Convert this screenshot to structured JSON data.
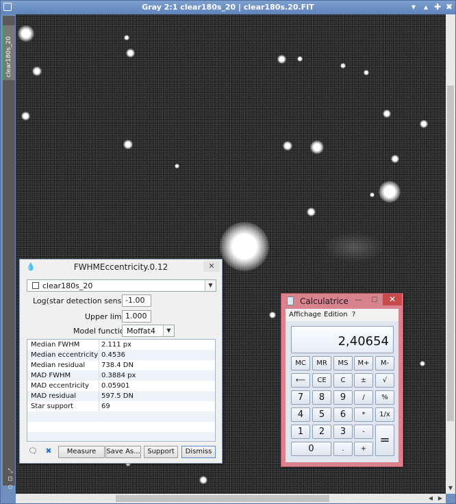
{
  "main_window": {
    "title": "Gray 2:1 clear180s_20 | clear180s.20.FIT",
    "side_tab_label": "clear180s_20",
    "controls": {
      "shade": "▾",
      "collapse": "▴",
      "maximize": "✚",
      "close": "✖"
    }
  },
  "fwhm_dialog": {
    "title": "FWHMEccentricity.0.12",
    "close": "✕",
    "image_select": {
      "value": "clear180s_20"
    },
    "sensitivity": {
      "label": "Log(star detection sensitivity):",
      "value": "-1.00"
    },
    "upper_limit": {
      "label": "Upper limit:",
      "value": "1.000"
    },
    "model_function": {
      "label": "Model function:",
      "value": "Moffat4"
    },
    "results": [
      {
        "name": "Median FWHM",
        "value": "2.111 px"
      },
      {
        "name": "Median eccentricity",
        "value": "0.4536"
      },
      {
        "name": "Median residual",
        "value": "738.4 DN"
      },
      {
        "name": "MAD FWHM",
        "value": "0.3884 px"
      },
      {
        "name": "MAD eccentricity",
        "value": "0.05901"
      },
      {
        "name": "MAD residual",
        "value": "597.5 DN"
      },
      {
        "name": "Star support",
        "value": "69"
      }
    ],
    "buttons": {
      "measure": "Measure",
      "save_as": "Save As...",
      "support": "Support",
      "dismiss": "Dismiss"
    }
  },
  "calculator": {
    "title": "Calculatrice",
    "title_controls": {
      "minimize": "—",
      "maximize": "☐",
      "close": "✕"
    },
    "menu": {
      "view": "Affichage",
      "edit": "Edition",
      "help": "?"
    },
    "display": "2,40654",
    "keys": {
      "mc": "MC",
      "mr": "MR",
      "ms": "MS",
      "mplus": "M+",
      "mminus": "M-",
      "back": "⟵",
      "ce": "CE",
      "c": "C",
      "pm": "±",
      "sqrt": "√",
      "k7": "7",
      "k8": "8",
      "k9": "9",
      "div": "/",
      "pct": "%",
      "k4": "4",
      "k5": "5",
      "k6": "6",
      "mul": "*",
      "inv": "1/x",
      "k1": "1",
      "k2": "2",
      "k3": "3",
      "sub": "-",
      "eq": "=",
      "k0": "0",
      "dot": ".",
      "add": "+"
    }
  }
}
